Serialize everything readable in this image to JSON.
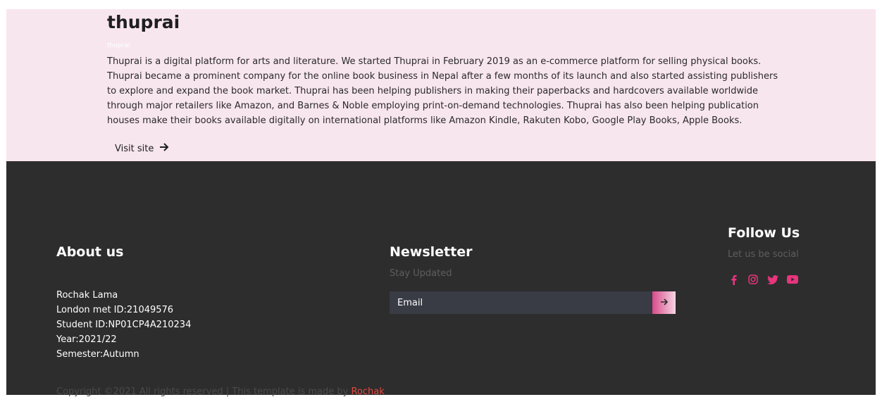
{
  "hero": {
    "title": "thuprai",
    "tag": "thuprai",
    "description": "Thuprai is a digital platform for arts and literature. We started Thuprai in February 2019 as an e-commerce platform for selling physical books. Thuprai became a prominent company for the online book business in Nepal after a few months of its launch and also started assisting publishers to explore and expand the book market. Thuprai has been helping publishers in making their paperbacks and hardcovers available worldwide through major retailers like Amazon, and Barnes & Noble employing print-on-demand technologies. Thuprai has also been helping publication houses make their books available digitally on international platforms like Amazon Kindle, Rakuten Kobo, Google Play Books, Apple Books.",
    "visit_label": "Visit site",
    "visit_icon": "arrow-right-icon"
  },
  "footer": {
    "about": {
      "title": "About us",
      "lines": [
        "Rochak Lama",
        "London met ID:21049576",
        "Student ID:NP01CP4A210234",
        "Year:2021/22",
        "Semester:Autumn"
      ]
    },
    "newsletter": {
      "title": "Newsletter",
      "subtitle": "Stay Updated",
      "email_placeholder": "Email",
      "submit_icon": "arrow-right-icon"
    },
    "follow": {
      "title": "Follow Us",
      "subtitle": "Let us be social",
      "icons": [
        "facebook-icon",
        "instagram-icon",
        "twitter-icon",
        "youtube-icon"
      ],
      "accent_color": "#e8357d"
    },
    "copyright": {
      "text": "Copyright ©2021 All rights reserved | This template is made by ",
      "link": "Rochak"
    }
  },
  "colors": {
    "hero_bg": "#f8e6ee",
    "footer_bg": "#2d2d2d",
    "accent": "#e8357d",
    "link": "#e2483f"
  }
}
